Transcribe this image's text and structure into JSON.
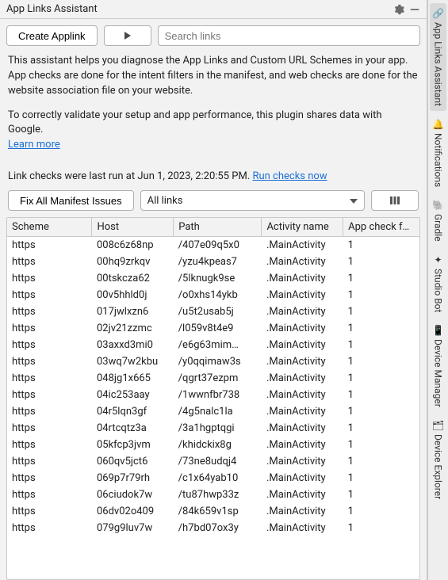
{
  "title": "App Links Assistant",
  "toolbar": {
    "create_label": "Create Applink",
    "search_placeholder": "Search links"
  },
  "description": {
    "p1": "This assistant helps you diagnose the App Links and Custom URL Schemes in your app. App checks are done for the intent filters in the manifest, and web checks are done for the website association file on your website.",
    "p2": "To correctly validate your setup and app performance, this plugin shares data with Google.",
    "learn_more": "Learn more"
  },
  "status": {
    "prefix": "Link checks were last run at ",
    "timestamp": "Jun 1, 2023, 2:20:55 PM",
    "suffix": ".  ",
    "action": "Run checks now"
  },
  "filters": {
    "fix_label": "Fix All Manifest Issues",
    "select_value": "All links"
  },
  "table": {
    "headers": {
      "scheme": "Scheme",
      "host": "Host",
      "path": "Path",
      "activity": "Activity name",
      "appcheck": "App check f…"
    },
    "rows": [
      {
        "scheme": "https",
        "host": "008c6z68np",
        "path": "/407e09q5x0",
        "activity": ".MainActivity",
        "appcheck": "1"
      },
      {
        "scheme": "https",
        "host": "00hq9zrkqv",
        "path": "/yzu4kpeas7",
        "activity": ".MainActivity",
        "appcheck": "1"
      },
      {
        "scheme": "https",
        "host": "00tskcza62",
        "path": "/5lknugk9se",
        "activity": ".MainActivity",
        "appcheck": "1"
      },
      {
        "scheme": "https",
        "host": "00v5hhld0j",
        "path": "/o0xhs14ykb",
        "activity": ".MainActivity",
        "appcheck": "1"
      },
      {
        "scheme": "https",
        "host": "017jwlxzn6",
        "path": "/u5t2usab5j",
        "activity": ".MainActivity",
        "appcheck": "1"
      },
      {
        "scheme": "https",
        "host": "02jv21zzmc",
        "path": "/l059v8t4e9",
        "activity": ".MainActivity",
        "appcheck": "1"
      },
      {
        "scheme": "https",
        "host": "03axxd3mi0",
        "path": "/e6g63mim…",
        "activity": ".MainActivity",
        "appcheck": "1"
      },
      {
        "scheme": "https",
        "host": "03wq7w2kbu",
        "path": "/y0qqimaw3s",
        "activity": ".MainActivity",
        "appcheck": "1"
      },
      {
        "scheme": "https",
        "host": "048jg1x665",
        "path": "/qgrt37ezpm",
        "activity": ".MainActivity",
        "appcheck": "1"
      },
      {
        "scheme": "https",
        "host": "04ic253aay",
        "path": "/1wwnfbr738",
        "activity": ".MainActivity",
        "appcheck": "1"
      },
      {
        "scheme": "https",
        "host": "04r5lqn3gf",
        "path": "/4g5nalc1la",
        "activity": ".MainActivity",
        "appcheck": "1"
      },
      {
        "scheme": "https",
        "host": "04rtcqtz3a",
        "path": "/3a1hgptqgi",
        "activity": ".MainActivity",
        "appcheck": "1"
      },
      {
        "scheme": "https",
        "host": "05kfcp3jvm",
        "path": "/khidckix8g",
        "activity": ".MainActivity",
        "appcheck": "1"
      },
      {
        "scheme": "https",
        "host": "060qv5jct6",
        "path": "/73ne8udqj4",
        "activity": ".MainActivity",
        "appcheck": "1"
      },
      {
        "scheme": "https",
        "host": "069p7r79rh",
        "path": "/c1x64yab10",
        "activity": ".MainActivity",
        "appcheck": "1"
      },
      {
        "scheme": "https",
        "host": "06ciudok7w",
        "path": "/tu87hwp33z",
        "activity": ".MainActivity",
        "appcheck": "1"
      },
      {
        "scheme": "https",
        "host": "06dv02o409",
        "path": "/84k659v1sp",
        "activity": ".MainActivity",
        "appcheck": "1"
      },
      {
        "scheme": "https",
        "host": "079g9luv7w",
        "path": "/h7bd07ox3y",
        "activity": ".MainActivity",
        "appcheck": "1"
      }
    ]
  },
  "sidebar": {
    "items": [
      {
        "label": "App Links Assistant",
        "icon": "🔗",
        "active": true
      },
      {
        "label": "Notifications",
        "icon": "🔔",
        "active": false
      },
      {
        "label": "Gradle",
        "icon": "🐘",
        "active": false
      },
      {
        "label": "Studio Bot",
        "icon": "✦",
        "active": false
      },
      {
        "label": "Device Manager",
        "icon": "📱",
        "active": false
      },
      {
        "label": "Device Explorer",
        "icon": "🗂",
        "active": false
      }
    ]
  }
}
